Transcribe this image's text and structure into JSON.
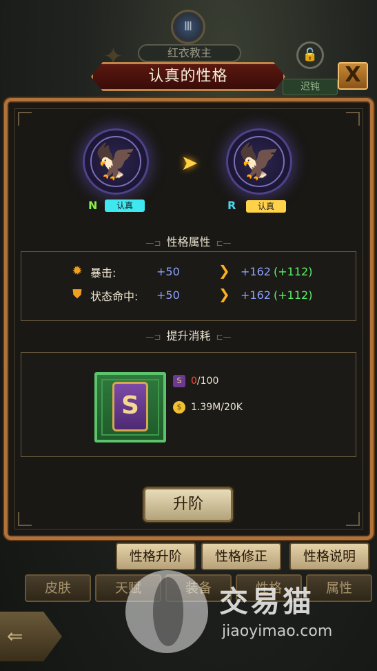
{
  "background": {
    "top_banner": "红衣教主",
    "emblem_numeral": "Ⅲ",
    "tag_dull": "迟钝"
  },
  "header": {
    "title": "认真的性格",
    "close_icon": "X"
  },
  "trait_upgrade": {
    "from": {
      "grade": "N",
      "name": "认真",
      "grade_color": "#8cf04a",
      "tag_color": "#3fe8f0"
    },
    "to": {
      "grade": "R",
      "name": "认真",
      "grade_color": "#49d7f0",
      "tag_color": "#ffd24a"
    },
    "arrow_icon": "arrow-right-glow-icon"
  },
  "sections": {
    "attributes_title": "性格属性",
    "cost_title": "提升消耗"
  },
  "attributes": [
    {
      "icon": "crit-burst-icon",
      "name": "暴击:",
      "current": "+50",
      "next": "+162",
      "increase": "(+112)"
    },
    {
      "icon": "shield-icon",
      "name": "状态命中:",
      "current": "+50",
      "next": "+162",
      "increase": "(+112)"
    }
  ],
  "cost": {
    "item_icon": "trait-scroll-icon",
    "lines": [
      {
        "icon": "trait-scroll-small-icon",
        "have": "0",
        "need": "/100"
      },
      {
        "icon": "gold-coin-icon",
        "have": "1.39M",
        "need": "/20K"
      }
    ]
  },
  "upgrade_button": "升阶",
  "sub_tabs": [
    "性格升阶",
    "性格修正",
    "性格说明"
  ],
  "bottom_tabs": [
    "皮肤",
    "天赋",
    "装备",
    "性格",
    "属性"
  ],
  "watermark": {
    "brand": "交易猫",
    "url": "jiaoyimao.com"
  },
  "colors": {
    "frame": "#b2733a",
    "stat_blue": "#8aa2ff",
    "stat_green": "#5cf06a",
    "cost_red": "#ff4a3a"
  }
}
